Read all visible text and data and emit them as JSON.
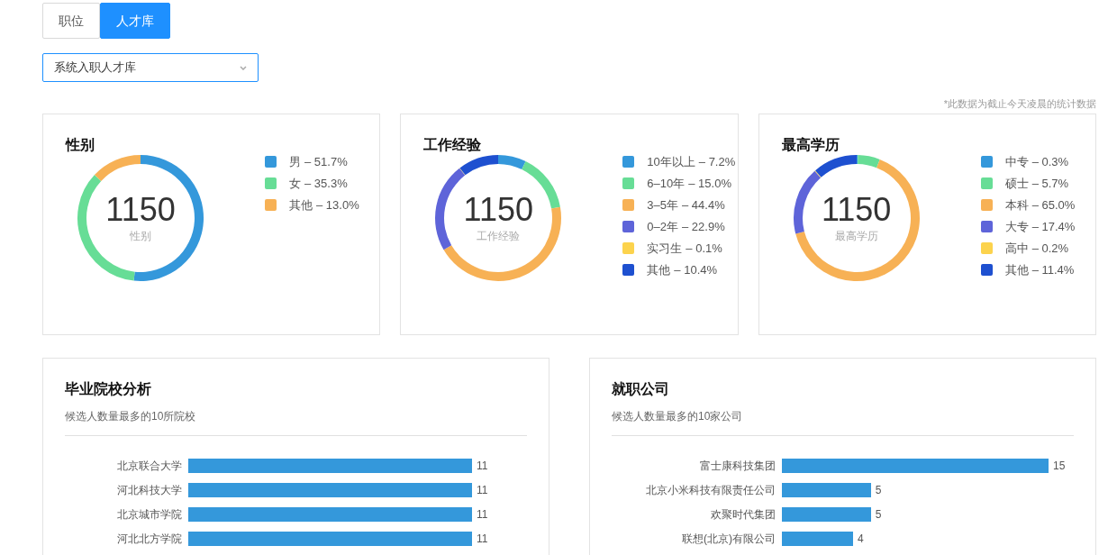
{
  "tabs": [
    {
      "label": "职位",
      "selected": false
    },
    {
      "label": "人才库",
      "selected": true
    }
  ],
  "select": {
    "value": "系统入职人才库"
  },
  "note": "*此数据为截止今天凌晨的统计数据",
  "donut_cards": [
    {
      "title": "性别",
      "total": "1150",
      "center_label": "性别",
      "legend": [
        {
          "share": "– 51.7%",
          "color": "#3498db"
        },
        {
          "share": "– 35.3%",
          "color": "#67dd96"
        },
        {
          "share": "– 13.0%",
          "color": "#f7b155"
        }
      ],
      "chart_data": {
        "type": "donut",
        "categories": [
          "男",
          "女",
          "其他"
        ],
        "values": [
          51.7,
          35.3,
          13.0
        ]
      }
    },
    {
      "title": "工作经验",
      "total": "1150",
      "center_label": "工作经验",
      "legend": [
        {
          "share": "– 7.2%",
          "color": "#3498db"
        },
        {
          "share": "– 15.0%",
          "color": "#67dd96"
        },
        {
          "share": "– 44.4%",
          "color": "#f7b155"
        },
        {
          "share": "– 22.9%",
          "color": "#5e64d9"
        },
        {
          "share": "– 0.1%",
          "color": "#fcd34d"
        },
        {
          "share": "– 10.4%",
          "color": "#1e50d0"
        }
      ],
      "chart_data": {
        "type": "donut",
        "categories": [
          "10年以上",
          "6–10年",
          "3–5年",
          "0–2年",
          "实习生",
          "其他"
        ],
        "values": [
          7.2,
          15.0,
          44.4,
          22.9,
          0.1,
          10.4
        ]
      }
    },
    {
      "title": "最高学历",
      "total": "1150",
      "center_label": "最高学历",
      "legend": [
        {
          "share": "– 0.3%",
          "color": "#3498db"
        },
        {
          "share": "– 5.7%",
          "color": "#67dd96"
        },
        {
          "share": "– 65.0%",
          "color": "#f7b155"
        },
        {
          "share": "– 17.4%",
          "color": "#5e64d9"
        },
        {
          "share": "– 0.2%",
          "color": "#fcd34d"
        },
        {
          "share": "– 11.4%",
          "color": "#1e50d0"
        }
      ],
      "chart_data": {
        "type": "donut",
        "categories": [
          "中专",
          "硕士",
          "本科",
          "大专",
          "高中",
          "其他"
        ],
        "values": [
          0.3,
          5.7,
          65.0,
          17.4,
          0.2,
          11.4
        ]
      }
    }
  ],
  "bar_cards": [
    {
      "title": "毕业院校分析",
      "subtitle": "候选人数量最多的10所院校",
      "chart_data": {
        "type": "bar",
        "orientation": "horizontal",
        "categories": [
          "北京联合大学",
          "河北科技大学",
          "北京城市学院",
          "河北北方学院"
        ],
        "series": [
          {
            "color": "#3498db",
            "values": [
              11,
              11,
              11,
              11
            ]
          }
        ],
        "data_labels": true
      }
    },
    {
      "title": "就职公司",
      "subtitle": "候选人数量最多的10家公司",
      "chart_data": {
        "type": "bar",
        "orientation": "horizontal",
        "categories": [
          "富士康科技集团",
          "北京小米科技有限责任公司",
          "欢聚时代集团",
          "联想(北京)有限公司"
        ],
        "series": [
          {
            "color": "#3498db",
            "values": [
              15,
              5,
              5,
              4
            ]
          }
        ],
        "data_labels": true
      }
    }
  ]
}
